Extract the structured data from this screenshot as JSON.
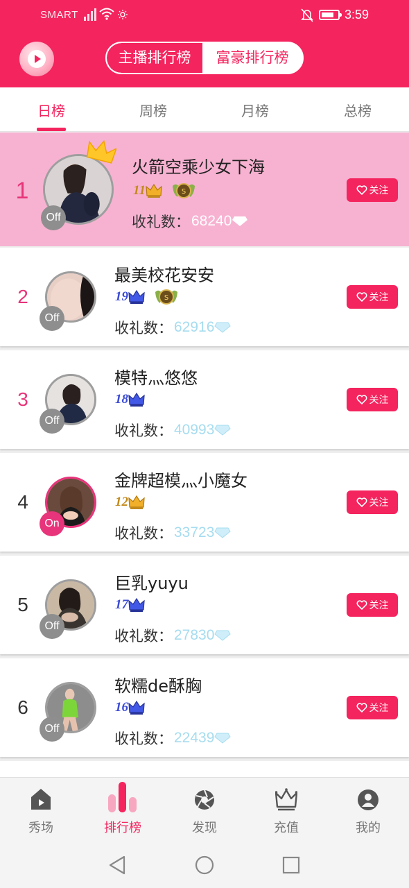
{
  "status_bar": {
    "carrier": "SMART",
    "time": "3:59"
  },
  "colors": {
    "brand": "#f4245e",
    "rank_accent": "#e8347a",
    "gift_value": "#a6dcef",
    "top_row_bg": "#f7b2d1",
    "level_gold": "#c28a1c",
    "level_blue": "#3b4bd6"
  },
  "header": {
    "logo_icon": "play-logo-icon",
    "toggle": {
      "active": "主播排行榜",
      "inactive": "富豪排行榜"
    }
  },
  "tabs": [
    {
      "label": "日榜",
      "active": true
    },
    {
      "label": "周榜",
      "active": false
    },
    {
      "label": "月榜",
      "active": false
    },
    {
      "label": "总榜",
      "active": false
    }
  ],
  "gifts_label": "收礼数：",
  "follow_label": "关注",
  "rankings": [
    {
      "rank": "1",
      "name": "火箭空乘少女下海",
      "level": "11",
      "level_tier": "gold",
      "medal": "green-medal-icon",
      "status": "Off",
      "gifts": "68240"
    },
    {
      "rank": "2",
      "name": "最美校花安安",
      "level": "19",
      "level_tier": "blue",
      "medal": "green-medal-icon",
      "status": "Off",
      "gifts": "62916"
    },
    {
      "rank": "3",
      "name": "模特灬悠悠",
      "level": "18",
      "level_tier": "blue",
      "status": "Off",
      "gifts": "40993"
    },
    {
      "rank": "4",
      "name": "金牌超模灬小魔女",
      "level": "12",
      "level_tier": "gold",
      "status": "On",
      "gifts": "33723"
    },
    {
      "rank": "5",
      "name": "巨乳yuyu",
      "level": "17",
      "level_tier": "blue",
      "status": "Off",
      "gifts": "27830"
    },
    {
      "rank": "6",
      "name": "软糯de酥胸",
      "level": "16",
      "level_tier": "blue",
      "status": "Off",
      "gifts": "22439"
    }
  ],
  "bottom_nav": [
    {
      "label": "秀场",
      "icon": "home-play-icon",
      "active": false
    },
    {
      "label": "排行榜",
      "icon": "ranking-bars-icon",
      "active": true
    },
    {
      "label": "发现",
      "icon": "camera-aperture-icon",
      "active": false
    },
    {
      "label": "充值",
      "icon": "crown-icon",
      "active": false
    },
    {
      "label": "我的",
      "icon": "user-icon",
      "active": false
    }
  ],
  "system_nav": [
    "back-icon",
    "home-icon",
    "recents-icon"
  ]
}
